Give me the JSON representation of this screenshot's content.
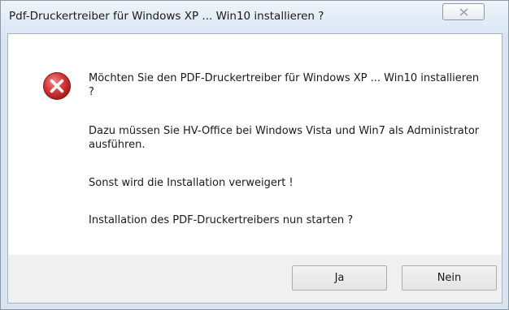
{
  "window": {
    "title": "Pdf-Druckertreiber für Windows XP ... Win10 installieren ?"
  },
  "icons": {
    "close": "close-icon",
    "message": "error-icon"
  },
  "message": {
    "line1": "Möchten Sie den PDF-Druckertreiber für Windows XP ... Win10 installieren ?",
    "line2": "Dazu müssen Sie HV-Office bei Windows Vista und Win7 als Administrator ausführen.",
    "line3": "Sonst wird die Installation verweigert !",
    "line4": "Installation des PDF-Druckertreibers nun starten ?"
  },
  "buttons": {
    "yes": "Ja",
    "no": "Nein"
  },
  "colors": {
    "error_red": "#c8282d",
    "titlebar": "#dbe7f4",
    "footer": "#f0f0f0"
  }
}
